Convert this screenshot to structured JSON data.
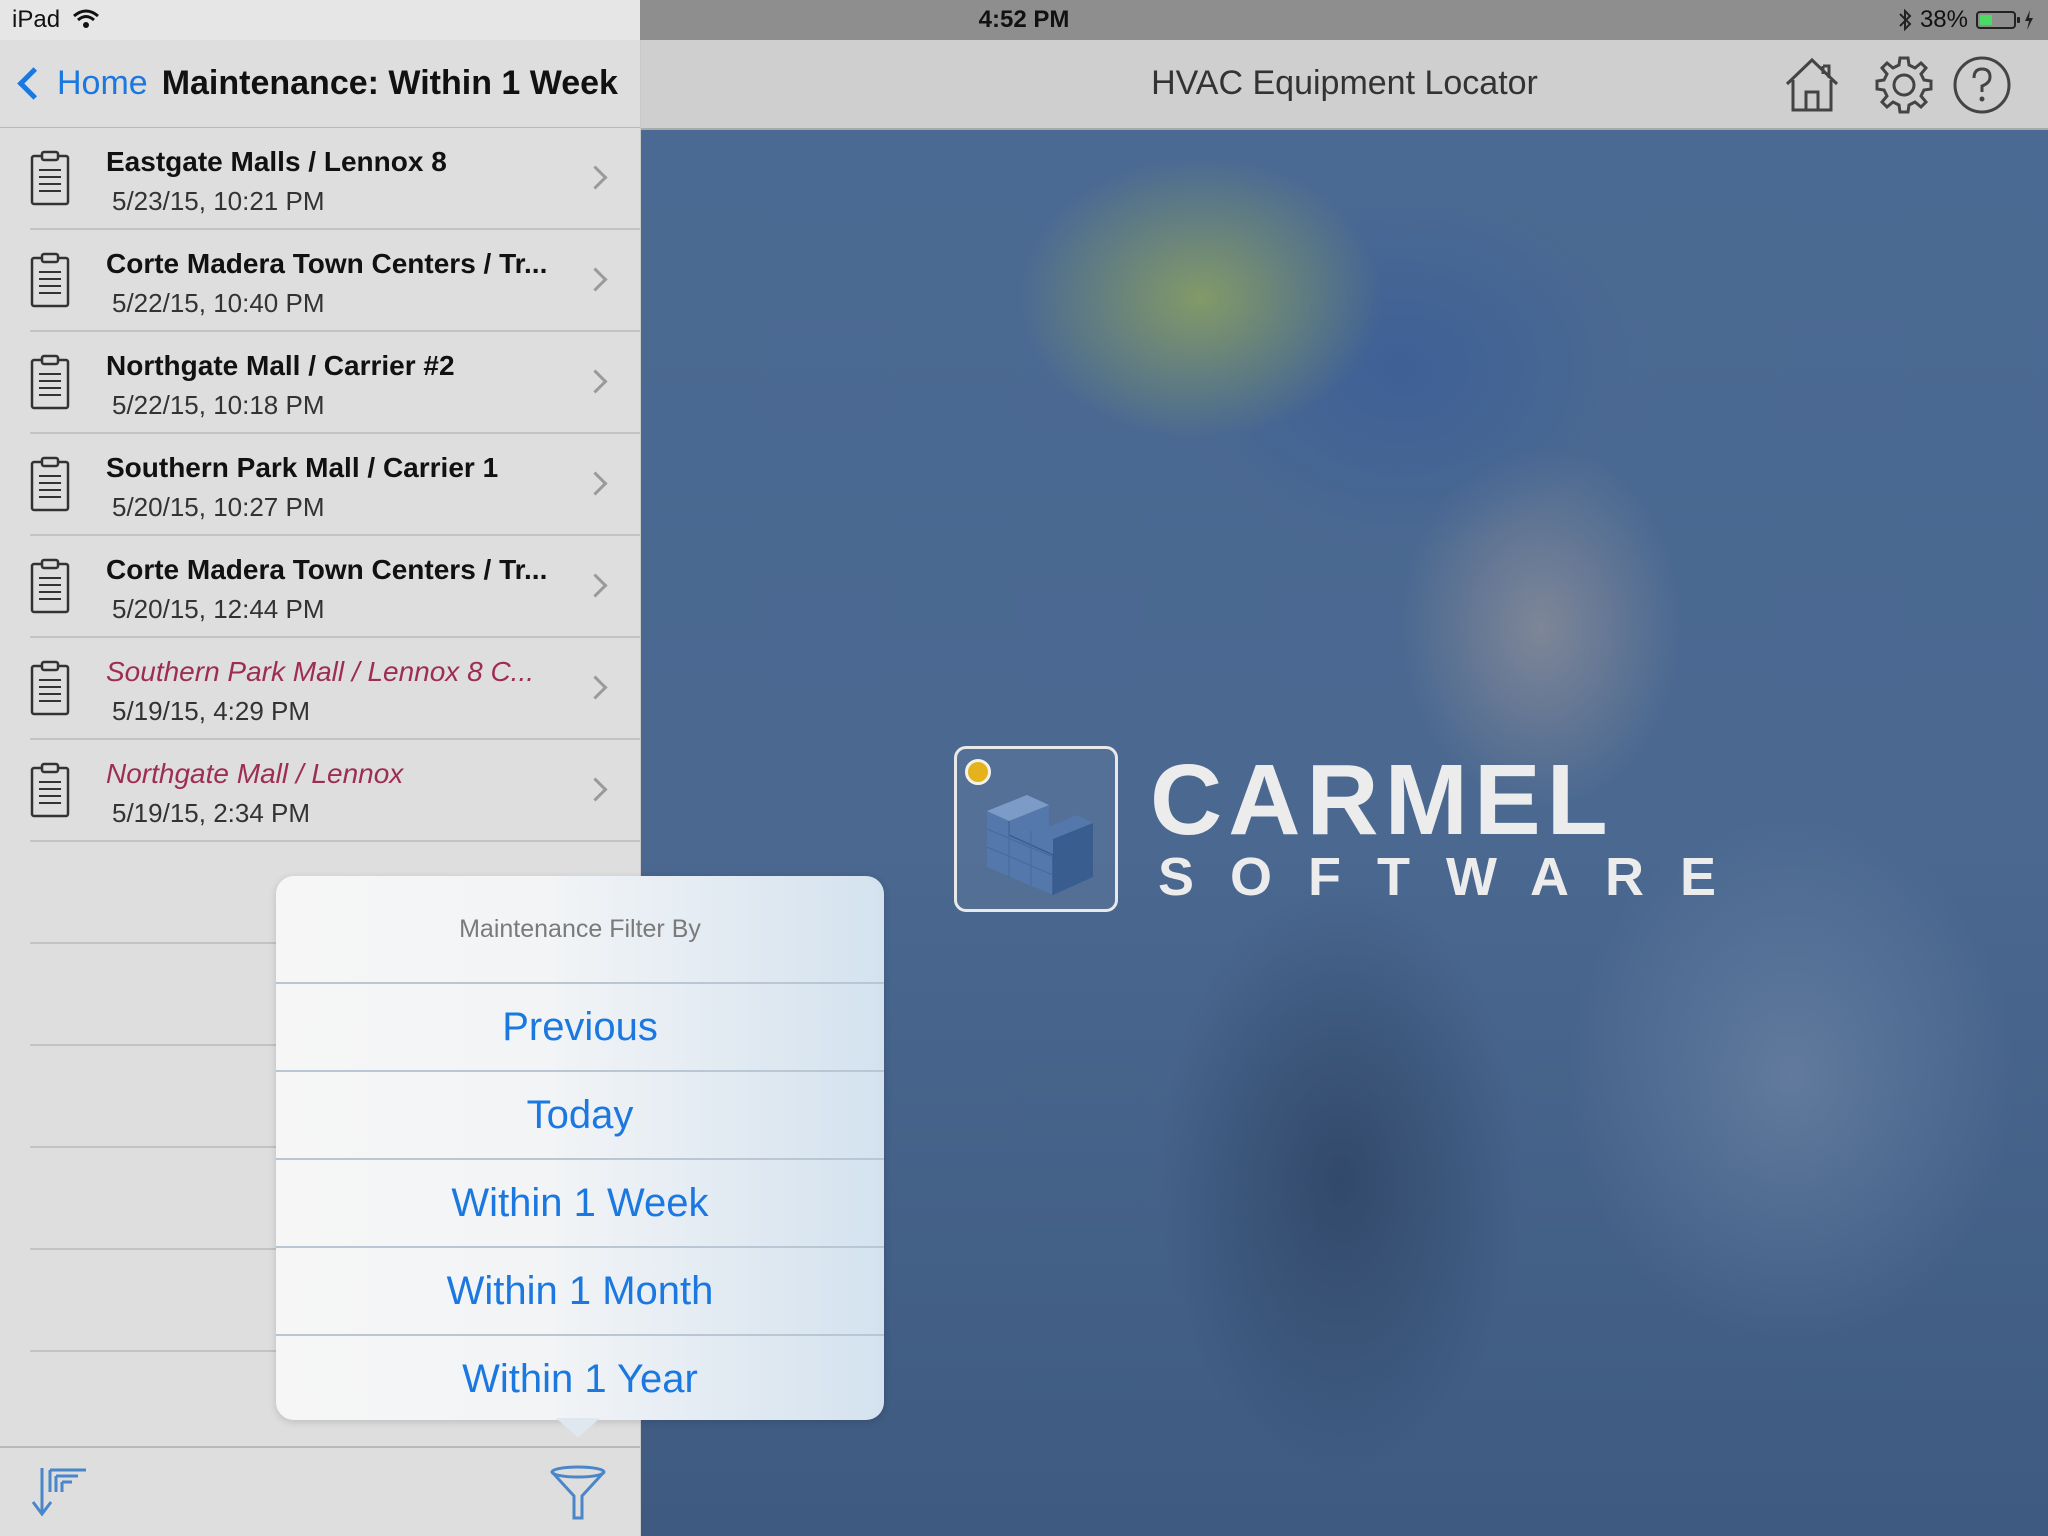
{
  "status_bar": {
    "device": "iPad",
    "time": "4:52 PM",
    "battery": "38%",
    "battery_level": 0.38
  },
  "master": {
    "back_label": "Home",
    "title": "Maintenance: Within 1 Week",
    "items": [
      {
        "title": "Eastgate Malls / Lennox 8",
        "date": "5/23/15, 10:21 PM",
        "style": "normal"
      },
      {
        "title": "Corte Madera Town Centers / Tr...",
        "date": "5/22/15, 10:40 PM",
        "style": "normal"
      },
      {
        "title": "Northgate Mall / Carrier #2",
        "date": "5/22/15, 10:18 PM",
        "style": "normal"
      },
      {
        "title": "Southern Park Mall / Carrier 1",
        "date": "5/20/15, 10:27 PM",
        "style": "normal"
      },
      {
        "title": "Corte Madera Town Centers / Tr...",
        "date": "5/20/15, 12:44 PM",
        "style": "normal"
      },
      {
        "title": "Southern Park Mall / Lennox 8 C...",
        "date": "5/19/15, 4:29 PM",
        "style": "italic"
      },
      {
        "title": "Northgate Mall / Lennox",
        "date": "5/19/15, 2:34 PM",
        "style": "italic"
      }
    ],
    "toolbar": {
      "sort_icon": "sort-icon",
      "filter_icon": "filter-funnel-icon"
    }
  },
  "detail": {
    "title": "HVAC Equipment Locator",
    "icons": [
      "home-icon",
      "gear-icon",
      "help-icon"
    ],
    "logo": {
      "word": "CARMEL",
      "sub": "SOFTWARE"
    }
  },
  "popover": {
    "title": "Maintenance Filter By",
    "options": [
      "Previous",
      "Today",
      "Within 1 Week",
      "Within 1 Month",
      "Within 1 Year"
    ]
  },
  "colors": {
    "accent": "#1b78e0",
    "unsynced_item": "#9e2d54"
  }
}
